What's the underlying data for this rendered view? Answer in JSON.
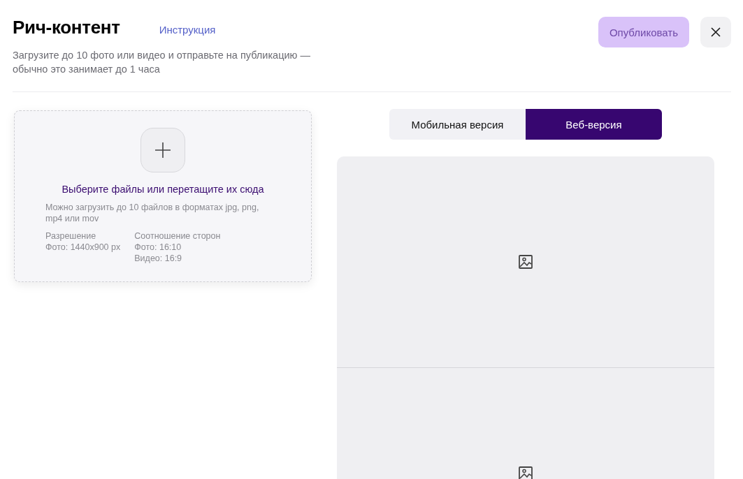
{
  "header": {
    "title": "Рич-контент",
    "help_link": "Инструкция",
    "subtitle": "Загрузите до 10 фото или видео и отправьте на публикацию — обычно это занимает до 1 часа",
    "publish_button": {
      "label": "Опубликовать",
      "disabled": true
    }
  },
  "upload": {
    "title": "Выберите файлы или перетащите их сюда",
    "hint": "Можно загрузить до 10 файлов в форматах jpg, png, mp4 или mov",
    "specs": [
      {
        "heading": "Разрешение",
        "lines": [
          "Фото: 1440x900 px"
        ]
      },
      {
        "heading": "Соотношение сторон",
        "lines": [
          "Фото: 16:10",
          "Видео: 16:9"
        ]
      }
    ]
  },
  "tabs": [
    {
      "label": "Мобильная версия",
      "selected": false
    },
    {
      "label": "Веб-версия",
      "selected": true
    }
  ],
  "preview": {
    "slots": [
      {
        "kind": "image"
      },
      {
        "kind": "image"
      }
    ]
  }
}
